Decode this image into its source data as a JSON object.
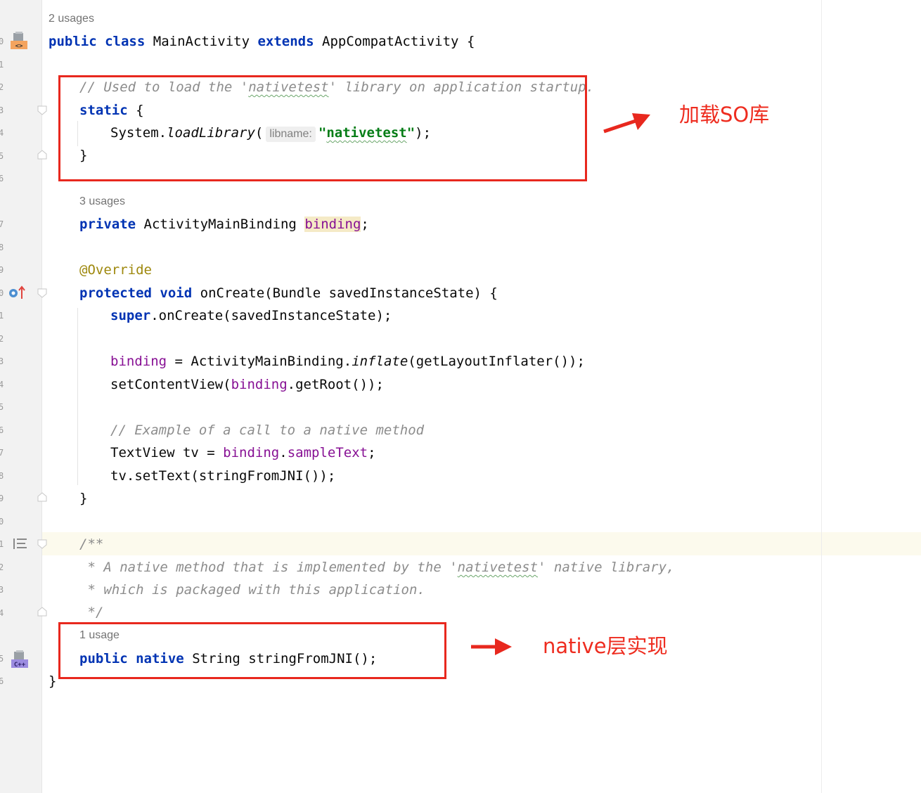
{
  "editor": {
    "line_numbers": [
      "0",
      "1",
      "2",
      "3",
      "4",
      "5",
      "6",
      "7",
      "8",
      "9",
      "0",
      "1",
      "2",
      "3",
      "4",
      "5",
      "6",
      "7",
      "8",
      "9",
      "0",
      "1",
      "2",
      "3",
      "4",
      "5",
      "6"
    ],
    "usages_class": "2 usages",
    "class_decl": {
      "kw1": "public",
      "kw2": "class",
      "name": "MainActivity",
      "kw3": "extends",
      "parent": "AppCompatActivity",
      "brace": "{"
    },
    "comment_load": {
      "pre": "// Used to load the '",
      "lib": "nativetest",
      "post": "' library on application startup."
    },
    "static_kw": "static",
    "brace_open": "{",
    "brace_close": "}",
    "load_call": {
      "pre": "System.",
      "method": "loadLibrary",
      "paren": "(",
      "hint": "libname:",
      "q1": "\"",
      "arg": "nativetest",
      "q2": "\"",
      "post": ");"
    },
    "usages_binding": "3 usages",
    "binding_decl": {
      "kw": "private",
      "type": "ActivityMainBinding",
      "name": "binding",
      "semi": ";"
    },
    "annotation": "@Override",
    "oncreate_decl": {
      "kw1": "protected",
      "kw2": "void",
      "rest": "onCreate(Bundle savedInstanceState) {"
    },
    "super_call": {
      "kw": "super",
      "rest": ".onCreate(savedInstanceState);"
    },
    "binding_assign": {
      "field": "binding",
      "mid": " = ActivityMainBinding.",
      "method": "inflate",
      "rest": "(getLayoutInflater());"
    },
    "set_content": {
      "pre": "setContentView(",
      "field": "binding",
      "rest": ".getRoot());"
    },
    "comment_example": "// Example of a call to a native method",
    "textview_line": {
      "pre": "TextView tv = ",
      "field": "binding",
      "dot": ".",
      "field2": "sampleText",
      "semi": ";"
    },
    "settext_line": "tv.setText(stringFromJNI());",
    "javadoc": {
      "open": "/**",
      "line1_pre": " * A native method that is implemented by the '",
      "line1_lib": "nativetest",
      "line1_post": "' native library,",
      "line2": " * which is packaged with this application.",
      "close": " */"
    },
    "usages_native": "1 usage",
    "native_decl": {
      "kw1": "public",
      "kw2": "native",
      "rest": "String stringFromJNI();"
    },
    "class_close": "}"
  },
  "gutter_icons": {
    "class_icon": "java-class-icon",
    "override_icon": "override-method-icon",
    "javadoc_icon": "javadoc-render-icon",
    "cpp_icon": "cpp-native-icon"
  },
  "annotations": {
    "load_so": "加载SO库",
    "native_impl": "native层实现",
    "color": "#ee2c1f"
  }
}
